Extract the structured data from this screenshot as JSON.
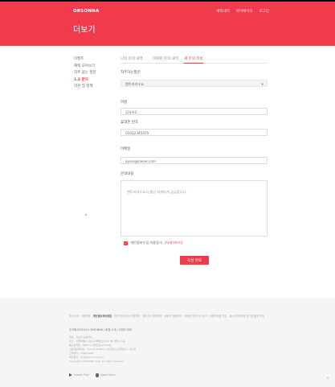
{
  "header": {
    "logo": "ORSONNA",
    "nav": [
      "예약내역",
      "마이페이지",
      "로그인"
    ],
    "title": "더보기"
  },
  "sidebar": {
    "items": [
      "이벤트",
      "혜택 모아보기",
      "자주 묻는 질문",
      "1:1 문의",
      "약관 및 정책"
    ],
    "active_index": 3
  },
  "tabs": [
    {
      "label": "나의 문의 내역",
      "active": false
    },
    {
      "label": "비회원 문의 내역",
      "active": false
    },
    {
      "label": "새 문의 작성",
      "active": true
    }
  ],
  "form": {
    "inquiry_type_label": "자주하는질문",
    "inquiry_type_value": "렌트카카오쇼",
    "name_label": "이름",
    "name_value": "김유라2",
    "phone_label": "휴대폰 번호",
    "phone_value": "01012345555",
    "email_label": "이메일",
    "email_value": "ayuro@naver.com",
    "content_label": "문의내용",
    "content_placeholder": "렌트카카오쇼의 팽균 자세하게 금금합니다.",
    "consent_text": "개인정보수집 이용동의",
    "consent_link": "[자세히보기]",
    "consent_checked": true,
    "submit_label": "작성 완료"
  },
  "footer": {
    "links": [
      "회사소개",
      "이용약관",
      "개인정보처리방침",
      "위치기반서비스이용약관",
      "렌트카사 회원약관",
      "렌트카 제휴문의",
      "마케팅 정보수신 동의",
      "여행자보험 가입",
      "청소년보호정책 및 개인정보 보호"
    ],
    "bold_link_index": 2,
    "company": "주식회사오르소나 ORSONNA  |  회원 소개  |  사업자 정보",
    "info_lines": [
      "대표 : 김소라 공동대표",
      "주소 : 서울특별시 강남구 테헤란로 412 예시빌딩 11층",
      "통신판매업 : 제2021-서울강남-01234호",
      "사업자등록번호 : 123-45-67890  |  개인정보 보호책임자 : 박소라",
      "고객센터 : 1588-0000",
      "제휴문의 : help@orsonna.com",
      "Copyright ORSONNA Corp. All rights reserved."
    ],
    "stores": [
      "Google Play",
      "Apple Store"
    ]
  },
  "colors": {
    "brand": "#f23a4d",
    "footer_bg": "#f5f5f5"
  }
}
